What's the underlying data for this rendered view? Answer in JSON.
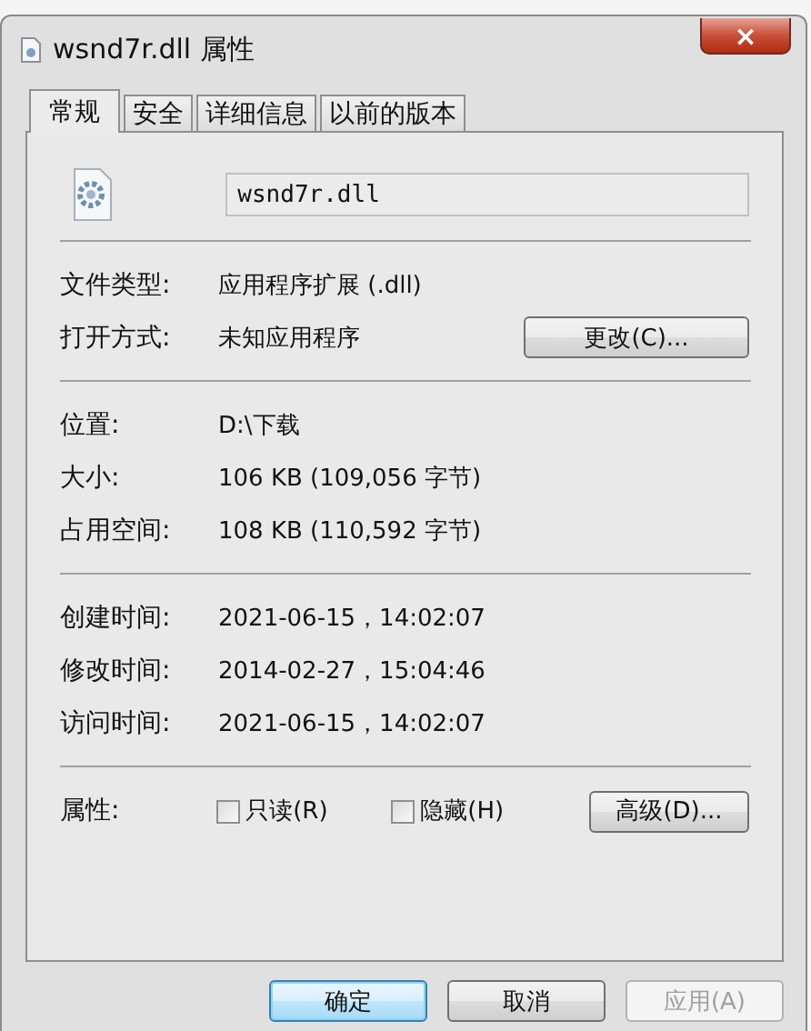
{
  "window": {
    "title": "wsnd7r.dll 属性",
    "close": "×"
  },
  "tabs": [
    {
      "label": "常规",
      "selected": true
    },
    {
      "label": "安全",
      "selected": false
    },
    {
      "label": "详细信息",
      "selected": false
    },
    {
      "label": "以前的版本",
      "selected": false
    }
  ],
  "file_name": {
    "value": "wsnd7r.dll"
  },
  "sections": [
    [
      {
        "label": "文件类型:",
        "value": "应用程序扩展 (.dll)"
      },
      {
        "label": "打开方式:",
        "value": "未知应用程序",
        "button": "更改(C)..."
      }
    ],
    [
      {
        "label": "位置:",
        "value": "D:\\下载"
      },
      {
        "label": "大小:",
        "value": "106 KB (109,056 字节)"
      },
      {
        "label": "占用空间:",
        "value": "108 KB (110,592 字节)"
      }
    ],
    [
      {
        "label": "创建时间:",
        "value": "2021-06-15，14:02:07"
      },
      {
        "label": "修改时间:",
        "value": "2014-02-27，15:04:46"
      },
      {
        "label": "访问时间:",
        "value": "2021-06-15，14:02:07"
      }
    ]
  ],
  "attributes": {
    "label": "属性:",
    "checkboxes": [
      {
        "label": "只读(R)",
        "checked": false
      },
      {
        "label": "隐藏(H)",
        "checked": false
      }
    ],
    "button": "高级(D)..."
  },
  "buttons": [
    {
      "label": "确定",
      "default": true,
      "disabled": false
    },
    {
      "label": "取消",
      "default": false,
      "disabled": false
    },
    {
      "label": "应用(A)",
      "default": false,
      "disabled": true
    }
  ]
}
